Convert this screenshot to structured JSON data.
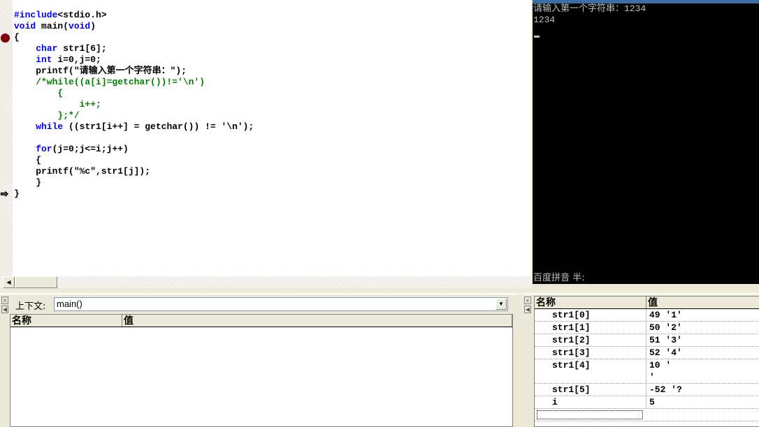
{
  "editor": {
    "lines": [
      "#include<stdio.h>",
      "void main(void)",
      "{",
      "    char str1[6];",
      "    int i=0,j=0;",
      "    printf(\"请输入第一个字符串：\");",
      "    /*while((a[i]=getchar())!='\\n')",
      "        {",
      "            i++;",
      "        };*/",
      "    while ((str1[i++] = getchar()) != '\\n');",
      "",
      "    for(j=0;j<=i;j++)",
      "    {",
      "    printf(\"%c\",str1[j]);",
      "    }",
      "}"
    ],
    "breakpoint_line": 3,
    "current_line": 17
  },
  "console": {
    "lines": [
      "请输入第一个字符串：1234",
      "1234"
    ],
    "ime_status": "百度拼音 半:"
  },
  "locals_panel": {
    "context_label": "上下文:",
    "context_value": "main()",
    "col_name": "名称",
    "col_value": "值"
  },
  "watch_panel": {
    "col_name": "名称",
    "col_value": "值",
    "rows": [
      {
        "name": "str1[0]",
        "value": "49 '1'"
      },
      {
        "name": "str1[1]",
        "value": "50 '2'"
      },
      {
        "name": "str1[2]",
        "value": "51 '3'"
      },
      {
        "name": "str1[3]",
        "value": "52 '4'"
      },
      {
        "name": "str1[4]",
        "value": "10 '\n'"
      },
      {
        "name": "str1[5]",
        "value": "-52 '?"
      },
      {
        "name": "i",
        "value": "5"
      }
    ]
  }
}
